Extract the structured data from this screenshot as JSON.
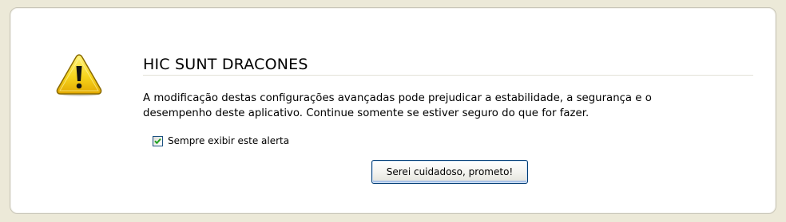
{
  "dialog": {
    "title": "HIC SUNT DRACONES",
    "message_line1": "A modificação destas configurações avançadas pode prejudicar a estabilidade, a segurança e o",
    "message_line2": "desempenho deste aplicativo. Continue somente se estiver seguro do que for fazer.",
    "checkbox": {
      "label": "Sempre exibir este alerta",
      "checked": true
    },
    "confirm_button_label": "Serei cuidadoso, prometo!",
    "icon": "warning-icon"
  },
  "colors": {
    "window_background": "#ece9d8",
    "panel_background": "#ffffff",
    "warning_yellow": "#f7d51d",
    "checkmark_green": "#21a121"
  }
}
